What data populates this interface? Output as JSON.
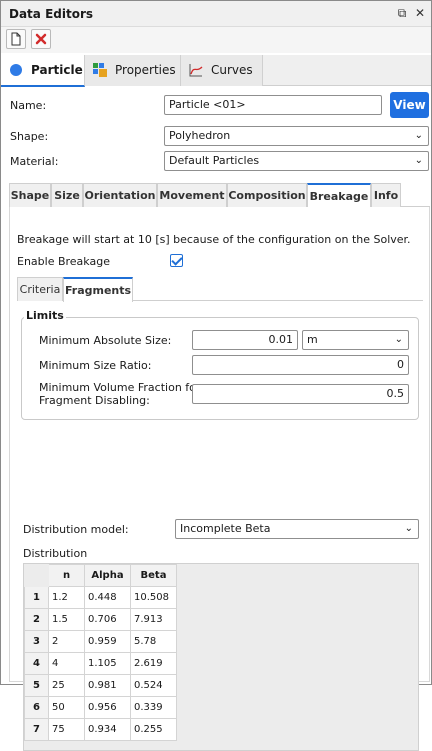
{
  "window": {
    "title": "Data Editors",
    "restore_glyph": "⧉",
    "close_glyph": "✕"
  },
  "main_tabs": [
    {
      "label": "Particle"
    },
    {
      "label": "Properties"
    },
    {
      "label": "Curves"
    }
  ],
  "form": {
    "name_label": "Name:",
    "name_value": "Particle <01>",
    "view_label": "View",
    "shape_label": "Shape:",
    "shape_value": "Polyhedron",
    "material_label": "Material:",
    "material_value": "Default Particles"
  },
  "sub_tabs": [
    "Shape",
    "Size",
    "Orientation",
    "Movement",
    "Composition",
    "Breakage",
    "Info"
  ],
  "breakage": {
    "info_text": "Breakage will start at 10 [s] because of the configuration on the Solver.",
    "enable_label": "Enable Breakage",
    "enabled": true,
    "inner_tabs": [
      "Criteria",
      "Fragments"
    ],
    "limits": {
      "title": "Limits",
      "min_abs_size_label": "Minimum Absolute Size:",
      "min_abs_size_value": "0.01",
      "min_abs_size_unit": "m",
      "min_size_ratio_label": "Minimum Size Ratio:",
      "min_size_ratio_value": "0",
      "min_vol_frac_label_1": "Minimum Volume Fraction for",
      "min_vol_frac_label_2": "Fragment Disabling:",
      "min_vol_frac_value": "0.5"
    },
    "distribution_model_label": "Distribution model:",
    "distribution_model_value": "Incomplete Beta",
    "distribution_label": "Distribution",
    "table": {
      "headers": [
        "n",
        "Alpha",
        "Beta"
      ],
      "rows": [
        {
          "idx": "1",
          "n": "1.2",
          "alpha": "0.448",
          "beta": "10.508"
        },
        {
          "idx": "2",
          "n": "1.5",
          "alpha": "0.706",
          "beta": "7.913"
        },
        {
          "idx": "3",
          "n": "2",
          "alpha": "0.959",
          "beta": "5.78"
        },
        {
          "idx": "4",
          "n": "4",
          "alpha": "1.105",
          "beta": "2.619"
        },
        {
          "idx": "5",
          "n": "25",
          "alpha": "0.981",
          "beta": "0.524"
        },
        {
          "idx": "6",
          "n": "50",
          "alpha": "0.956",
          "beta": "0.339"
        },
        {
          "idx": "7",
          "n": "75",
          "alpha": "0.934",
          "beta": "0.255"
        }
      ]
    }
  },
  "colors": {
    "accent": "#1f6fd6",
    "view_button": "#1f6fe0",
    "delete_icon": "#d22b2b"
  }
}
